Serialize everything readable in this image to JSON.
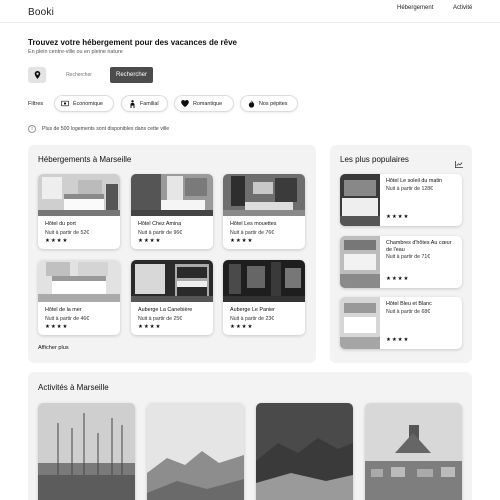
{
  "header": {
    "logo": "Booki",
    "nav": [
      "Hébergement",
      "Activité"
    ]
  },
  "hero": {
    "title": "Trouvez votre hébergement pour des vacances de rêve",
    "subtitle": "En plein centre-ville ou en pleine nature"
  },
  "search": {
    "placeholder": "Rechercher",
    "button": "Rechercher",
    "location_icon": "location-pin-icon"
  },
  "filters": {
    "label": "Filtres",
    "chips": [
      {
        "label": "Économique",
        "icon": "money-icon"
      },
      {
        "label": "Familial",
        "icon": "family-icon"
      },
      {
        "label": "Romantique",
        "icon": "heart-icon"
      },
      {
        "label": "Nos pépites",
        "icon": "gem-icon"
      }
    ]
  },
  "info": {
    "text": "Plus de 500 logements sont disponibles dans cette ville"
  },
  "hebergements": {
    "title": "Hébergements à Marseille",
    "more": "Afficher plus",
    "items": [
      {
        "name": "Hôtel du port",
        "price": "Nuit à partir de 52€",
        "stars": "★★★★"
      },
      {
        "name": "Hôtel Chez Amina",
        "price": "Nuit à partir de 96€",
        "stars": "★★★★"
      },
      {
        "name": "Hôtel Les mouettes",
        "price": "Nuit à partir de 76€",
        "stars": "★★★★"
      },
      {
        "name": "Hôtel de la mer",
        "price": "Nuit à partir de 46€",
        "stars": "★★★★"
      },
      {
        "name": "Auberge La Canebière",
        "price": "Nuit à partir de 25€",
        "stars": "★★★★"
      },
      {
        "name": "Auberge Le Panier",
        "price": "Nuit à partir de 23€",
        "stars": "★★★★"
      }
    ]
  },
  "populaires": {
    "title": "Les plus populaires",
    "icon": "trend-chart-icon",
    "items": [
      {
        "name": "Hôtel Le soleil du matin",
        "price": "Nuit à partir de 128€",
        "stars": "★★★★"
      },
      {
        "name": "Chambres d'hôtes Au cœur de l'eau",
        "price": "Nuit à partir de 71€",
        "stars": "★★★★"
      },
      {
        "name": "Hôtel Bleu et Blanc",
        "price": "Nuit à partir de 68€",
        "stars": "★★★★"
      }
    ]
  },
  "activites": {
    "title": "Activités à Marseille"
  }
}
